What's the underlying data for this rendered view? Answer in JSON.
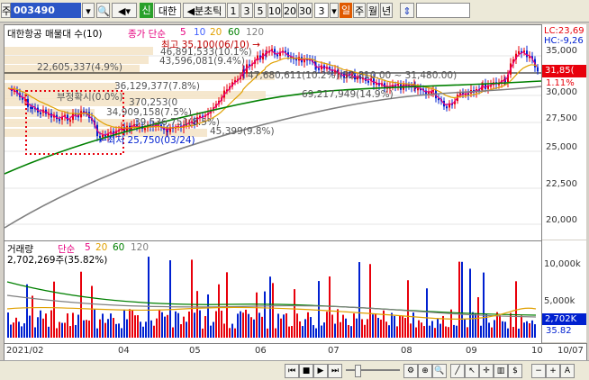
{
  "toolbar": {
    "market": "주",
    "code": "003490",
    "sin": "신",
    "name": "대한",
    "split_tick": "분초틱",
    "periods": [
      "1",
      "3",
      "5",
      "10",
      "20",
      "30"
    ],
    "count": "3",
    "day": "일",
    "week": "주",
    "month": "월",
    "year": "년"
  },
  "price_panel": {
    "title": "대한항공 매물대 수(10)",
    "ma_label": "종가 단순",
    "ma_periods": [
      "5",
      "10",
      "20",
      "60",
      "120"
    ],
    "lc": "LC:23,69",
    "hc": "HC:-9,26",
    "current": "31,85(",
    "change": "1.11%",
    "annotations": {
      "high": "최고 35,100(06/10) →",
      "low": "←최저 25,750(03/24)",
      "v1": "46,891,533(10.1%)",
      "v2": "43,596,081(9.4%)",
      "v3": "22,605,337(4.9%)",
      "v4": "36,129,377(7.8%)",
      "v5": "47,680,611(10.2%)(32,810.00 ~ 31,480.00)",
      "v6": "69,217,949(14.9%)",
      "v7": "부정확시(0.0%)",
      "v8": "370,253(0",
      "v9": "34,909,158(7.5%)",
      "v10": "39,536,751(8.5%)",
      "v11": "45,399(9.8%)"
    },
    "yticks": [
      "35,000",
      "32,500",
      "30,000",
      "27,500",
      "25,000",
      "22,500",
      "20,000"
    ]
  },
  "volume_panel": {
    "title": "거래량",
    "ma_label": "단순",
    "ma_periods": [
      "5",
      "20",
      "60",
      "120"
    ],
    "value": "2,702,269주(35.82%)",
    "yticks": [
      "10,000k",
      "5,000k"
    ],
    "current": "2,702K",
    "pct": "35.82"
  },
  "xaxis": [
    "2021/02",
    "04",
    "05",
    "06",
    "07",
    "08",
    "09",
    "10",
    "10/07"
  ],
  "colors": {
    "up": "#e8000b",
    "down": "#0020d0",
    "ma5": "#e6007e",
    "ma20": "#e0a000",
    "ma60": "#008000",
    "ma120": "#808080"
  }
}
